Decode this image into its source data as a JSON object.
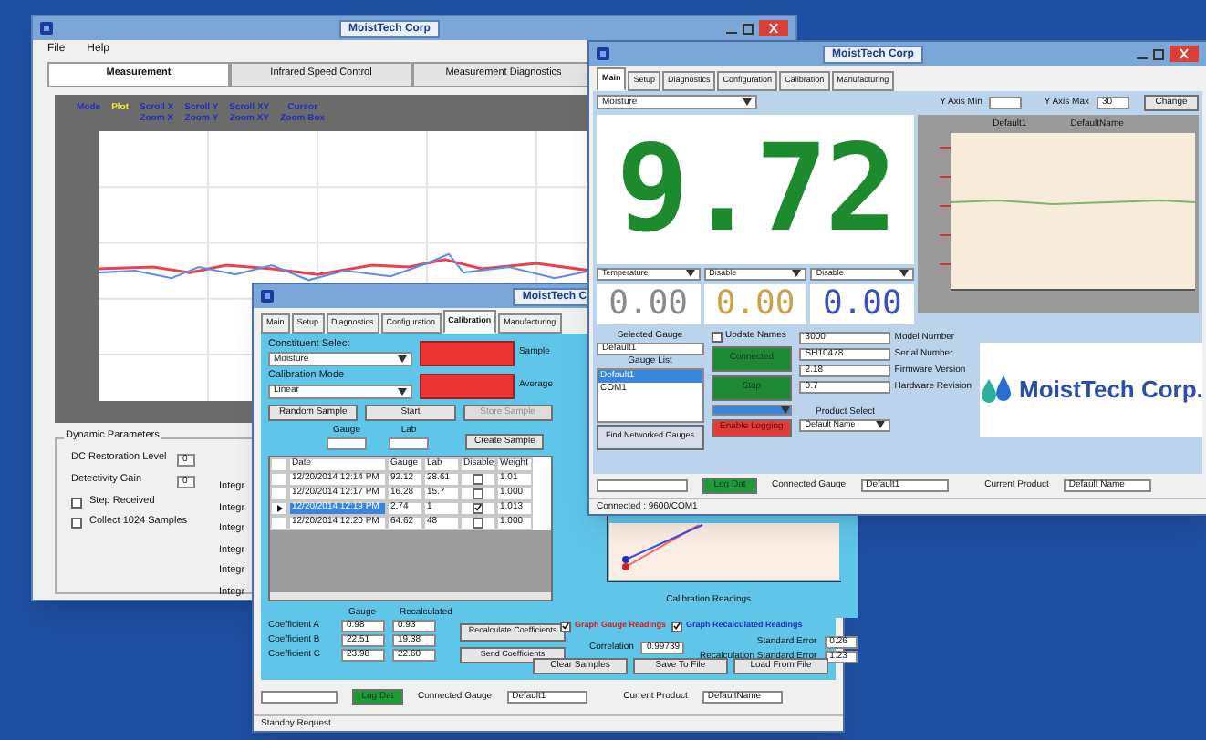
{
  "measurement_window": {
    "title": "MoistTech Corp",
    "menu": [
      "File",
      "Help"
    ],
    "tabs": [
      {
        "label": "Measurement",
        "selected": true
      },
      {
        "label": "Infrared Speed Control",
        "selected": false
      },
      {
        "label": "Measurement Diagnostics",
        "selected": false
      }
    ],
    "plot_toolbar": [
      {
        "lines": [
          "Mode"
        ],
        "selected": false
      },
      {
        "lines": [
          "Plot"
        ],
        "selected": true
      },
      {
        "lines": [
          "Scroll X",
          "Zoom X"
        ],
        "selected": false
      },
      {
        "lines": [
          "Scroll Y",
          "Zoom Y"
        ],
        "selected": false
      },
      {
        "lines": [
          "Scroll XY",
          "Zoom XY"
        ],
        "selected": false
      },
      {
        "lines": [
          "Cursor",
          "Zoom Box"
        ],
        "selected": false
      }
    ],
    "dynamic_parameters": {
      "title": "Dynamic Parameters",
      "fields": [
        {
          "label": "DC Restoration Level",
          "value": "0"
        },
        {
          "label": "Detectivity Gain",
          "value": "0"
        }
      ],
      "checkboxes": [
        {
          "label": "Step Received",
          "checked": false
        },
        {
          "label": "Collect 1024 Samples",
          "checked": false
        }
      ],
      "cut_labels": [
        "Integr",
        "Integr",
        "Integr",
        "Integr",
        "Integr",
        "Integr"
      ]
    }
  },
  "calibration_window": {
    "title": "MoistTech C",
    "tabs": [
      {
        "label": "Main",
        "selected": false
      },
      {
        "label": "Setup",
        "selected": false
      },
      {
        "label": "Diagnostics",
        "selected": false
      },
      {
        "label": "Configuration",
        "selected": false
      },
      {
        "label": "Calibration",
        "selected": true
      },
      {
        "label": "Manufacturing",
        "selected": false
      }
    ],
    "constituent_select": {
      "label": "Constituent Select",
      "value": "Moisture"
    },
    "calibration_mode": {
      "label": "Calibration Mode",
      "value": "Linear"
    },
    "displays": [
      "Sample",
      "Average"
    ],
    "buttons": [
      {
        "label": "Random Sample",
        "disabled": false
      },
      {
        "label": "Start",
        "disabled": false
      },
      {
        "label": "Store Sample",
        "disabled": true
      }
    ],
    "entry_labels": [
      "Gauge",
      "Lab"
    ],
    "create_button": "Create Sample",
    "table": {
      "columns": [
        "Date",
        "Gauge",
        "Lab",
        "Disable",
        "Weight"
      ],
      "rows": [
        {
          "date": "12/20/2014 12:14 PM",
          "gauge": "92.12",
          "lab": "28.61",
          "disable": false,
          "weight": "1.01",
          "selected": false
        },
        {
          "date": "12/20/2014 12:17 PM",
          "gauge": "16.28",
          "lab": "15.7",
          "disable": false,
          "weight": "1.000",
          "selected": false
        },
        {
          "date": "12/20/2014 12:19 PM",
          "gauge": "2.74",
          "lab": "1",
          "disable": true,
          "weight": "1.013",
          "selected": true
        },
        {
          "date": "12/20/2014 12:20 PM",
          "gauge": "64.62",
          "lab": "48",
          "disable": false,
          "weight": "1.000",
          "selected": false
        }
      ]
    },
    "coefficients": {
      "columns": [
        "Gauge",
        "Recalculated"
      ],
      "rows": [
        {
          "label": "Coefficient A",
          "gauge": "0.98",
          "recalculated": "0.93"
        },
        {
          "label": "Coefficient B",
          "gauge": "22.51",
          "recalculated": "19.38"
        },
        {
          "label": "Coefficient C",
          "gauge": "23.98",
          "recalculated": "22.60"
        }
      ]
    },
    "recalc_button": "Recalculate Coefficients",
    "send_button": "Send Coefficients",
    "chart_xlabel": "Calibration Readings",
    "graph_options": [
      {
        "label": "Graph Gauge Readings",
        "checked": true,
        "color": "#d02020"
      },
      {
        "label": "Graph Recalculated Readings",
        "checked": true,
        "color": "#2030c0"
      }
    ],
    "correlation": {
      "label": "Correlation",
      "value": "0.99739"
    },
    "standard_error": {
      "label": "Standard Error",
      "value": "0.26"
    },
    "recalc_error": {
      "label": "Recalculation Standard Error",
      "value": "1.23"
    },
    "bottom_buttons": [
      "Clear Samples",
      "Save To File",
      "Load From File"
    ],
    "log_button": "Log Dat",
    "connected_gauge": {
      "label": "Connected Gauge",
      "value": "Default1"
    },
    "current_product": {
      "label": "Current Product",
      "value": "DefaultName"
    },
    "status": "Standby Request"
  },
  "main_window": {
    "title": "MoistTech Corp",
    "tabs": [
      {
        "label": "Main",
        "selected": true
      },
      {
        "label": "Setup",
        "selected": false
      },
      {
        "label": "Diagnostics",
        "selected": false
      },
      {
        "label": "Configuration",
        "selected": false
      },
      {
        "label": "Calibration",
        "selected": false
      },
      {
        "label": "Manufacturing",
        "selected": false
      }
    ],
    "constituent": "Moisture",
    "y_axis_min": "Y Axis Min",
    "y_axis_max": {
      "label": "Y Axis Max",
      "value": "30"
    },
    "change_button": "Change",
    "reading": "9.72",
    "chart_legend": [
      "Default1",
      "DefaultName"
    ],
    "selectors": [
      "Temperature",
      "Disable",
      "Disable"
    ],
    "small_readings": [
      {
        "value": "0.00",
        "color": "#8a8a8a"
      },
      {
        "value": "0.00",
        "color": "#c9a24a"
      },
      {
        "value": "0.00",
        "color": "#3a4fc0"
      }
    ],
    "selected_gauge": {
      "label": "Selected Gauge",
      "value": "Default1"
    },
    "gauge_list": {
      "label": "Gauge List",
      "items": [
        {
          "label": "Default1",
          "selected": true
        },
        {
          "label": "COM1",
          "selected": false
        }
      ]
    },
    "find_button": "Find Networked Gauges",
    "update_names": {
      "label": "Update Names",
      "checked": false
    },
    "connect_button": "Connected",
    "stop_button": "Stop",
    "logging_button": "Enable Logging",
    "product_select": {
      "label": "Product Select",
      "value": "Default Name"
    },
    "info": [
      {
        "label": "Model Number",
        "value": "3000"
      },
      {
        "label": "Serial Number",
        "value": "SH10478"
      },
      {
        "label": "Firmware Version",
        "value": "2.18"
      },
      {
        "label": "Hardware Revision",
        "value": "0.7"
      }
    ],
    "logo": "MoistTech Corp.",
    "log_button": "Log Dat",
    "connected_gauge": {
      "label": "Connected Gauge",
      "value": "Default1"
    },
    "current_product": {
      "label": "Current Product",
      "value": "Default Name"
    },
    "status": "Connected : 9600/COM1"
  }
}
